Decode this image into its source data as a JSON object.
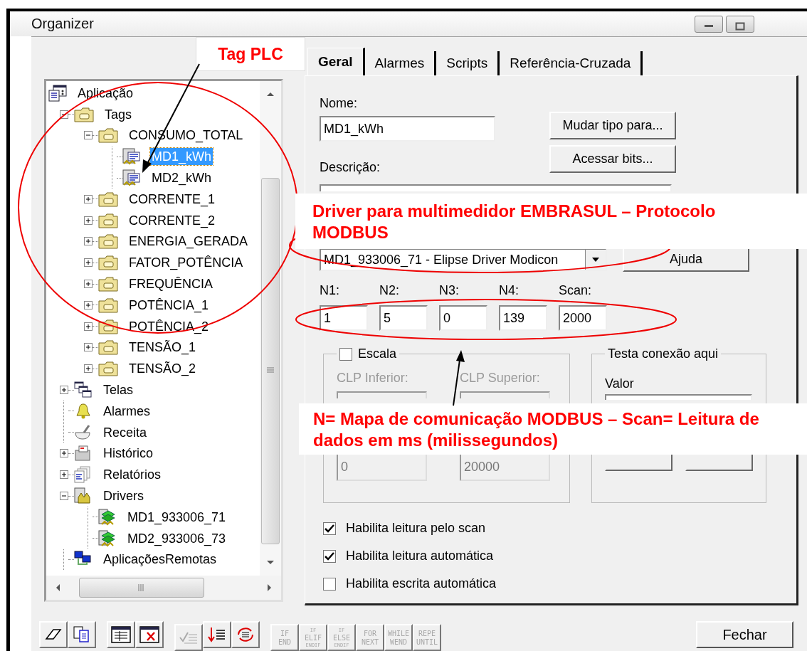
{
  "window": {
    "title": "Organizer"
  },
  "tree": [
    {
      "label": "Aplicação",
      "kind": "app",
      "selected": false,
      "children": [
        {
          "label": "Tags",
          "kind": "folder",
          "expanded": true,
          "selected": false,
          "children": [
            {
              "label": "CONSUMO_TOTAL",
              "kind": "folder",
              "expanded": true,
              "selected": false,
              "children": [
                {
                  "label": "MD1_kWh",
                  "kind": "tag",
                  "selected": true
                },
                {
                  "label": "MD2_kWh",
                  "kind": "tag",
                  "selected": false
                }
              ]
            },
            {
              "label": "CORRENTE_1",
              "kind": "folder",
              "expanded": false,
              "selected": false
            },
            {
              "label": "CORRENTE_2",
              "kind": "folder",
              "expanded": false,
              "selected": false
            },
            {
              "label": "ENERGIA_GERADA",
              "kind": "folder",
              "expanded": false,
              "selected": false
            },
            {
              "label": "FATOR_POTÊNCIA",
              "kind": "folder",
              "expanded": false,
              "selected": false
            },
            {
              "label": "FREQUÊNCIA",
              "kind": "folder",
              "expanded": false,
              "selected": false
            },
            {
              "label": "POTÊNCIA_1",
              "kind": "folder",
              "expanded": false,
              "selected": false
            },
            {
              "label": "POTÊNCIA_2",
              "kind": "folder",
              "expanded": false,
              "selected": false
            },
            {
              "label": "TENSÃO_1",
              "kind": "folder",
              "expanded": false,
              "selected": false
            },
            {
              "label": "TENSÃO_2",
              "kind": "folder",
              "expanded": false,
              "selected": false
            }
          ]
        },
        {
          "label": "Telas",
          "kind": "screens",
          "expanded": false,
          "selected": false
        },
        {
          "label": "Alarmes",
          "kind": "bell",
          "selected": false
        },
        {
          "label": "Receita",
          "kind": "recipe",
          "selected": false
        },
        {
          "label": "Histórico",
          "kind": "history",
          "expanded": false,
          "selected": false
        },
        {
          "label": "Relatórios",
          "kind": "reports",
          "expanded": false,
          "selected": false
        },
        {
          "label": "Drivers",
          "kind": "drivers",
          "expanded": true,
          "selected": false,
          "children": [
            {
              "label": "MD1_933006_71",
              "kind": "driver",
              "selected": false
            },
            {
              "label": "MD2_933006_73",
              "kind": "driver",
              "selected": false
            }
          ]
        },
        {
          "label": "AplicaçõesRemotas",
          "kind": "remote",
          "selected": false
        }
      ]
    }
  ],
  "tabs": [
    {
      "label": "Geral",
      "selected": true
    },
    {
      "label": "Alarmes",
      "selected": false
    },
    {
      "label": "Scripts",
      "selected": false
    },
    {
      "label": "Referência-Cruzada",
      "selected": false
    }
  ],
  "form": {
    "name_label": "Nome:",
    "name_value": "MD1_kWh",
    "description_label": "Descrição:",
    "side_buttons": [
      "Mudar tipo para...",
      "Acessar bits..."
    ],
    "driver_value": "MD1_933006_71 - Elipse Driver Modicon",
    "help_button": "Ajuda",
    "address": [
      {
        "label": "N1:",
        "value": "1"
      },
      {
        "label": "N2:",
        "value": "5"
      },
      {
        "label": "N3:",
        "value": "0"
      },
      {
        "label": "N4:",
        "value": "139"
      },
      {
        "label": "Scan:",
        "value": "2000"
      }
    ],
    "scale": {
      "label": "Escala",
      "checked": false,
      "lower_label": "CLP Inferior:",
      "upper_label": "CLP Superior:",
      "lower_value": "0",
      "upper_value": "20000"
    },
    "test": {
      "title": "Testa conexão aqui",
      "value_label": "Valor"
    },
    "options": [
      {
        "label": "Habilita leitura pelo scan",
        "checked": true
      },
      {
        "label": "Habilita leitura automática",
        "checked": true
      },
      {
        "label": "Habilita escrita automática",
        "checked": false
      }
    ]
  },
  "toolbar": [
    {
      "kind": "eraser",
      "disabled": false
    },
    {
      "kind": "copy",
      "disabled": false
    },
    {
      "kind": "table",
      "disabled": false
    },
    {
      "kind": "tabledelete",
      "disabled": false
    },
    {
      "kind": "checklist",
      "disabled": true
    },
    {
      "kind": "sortdown",
      "disabled": false
    },
    {
      "kind": "refresh",
      "disabled": false
    }
  ],
  "script_buttons": [
    {
      "lines": [
        "IF",
        "END"
      ],
      "disabled": true
    },
    {
      "lines": [
        "IF",
        "ELIF",
        "ENDIF"
      ],
      "disabled": true
    },
    {
      "lines": [
        "IF",
        "ELSE",
        "ENDIF"
      ],
      "disabled": true
    },
    {
      "lines": [
        "FOR",
        "NEXT"
      ],
      "disabled": true
    },
    {
      "lines": [
        "WHILE",
        "WEND"
      ],
      "disabled": true
    },
    {
      "lines": [
        "REPE",
        "UNTIL"
      ],
      "disabled": true
    }
  ],
  "close_button": "Fechar",
  "callouts": [
    {
      "text": "Tag PLC"
    },
    {
      "text": "Driver para multimedidor EMBRASUL – Protocolo MODBUS"
    },
    {
      "text": "N= Mapa de comunicação MODBUS – Scan= Leitura de dados em ms (milissegundos)"
    }
  ]
}
